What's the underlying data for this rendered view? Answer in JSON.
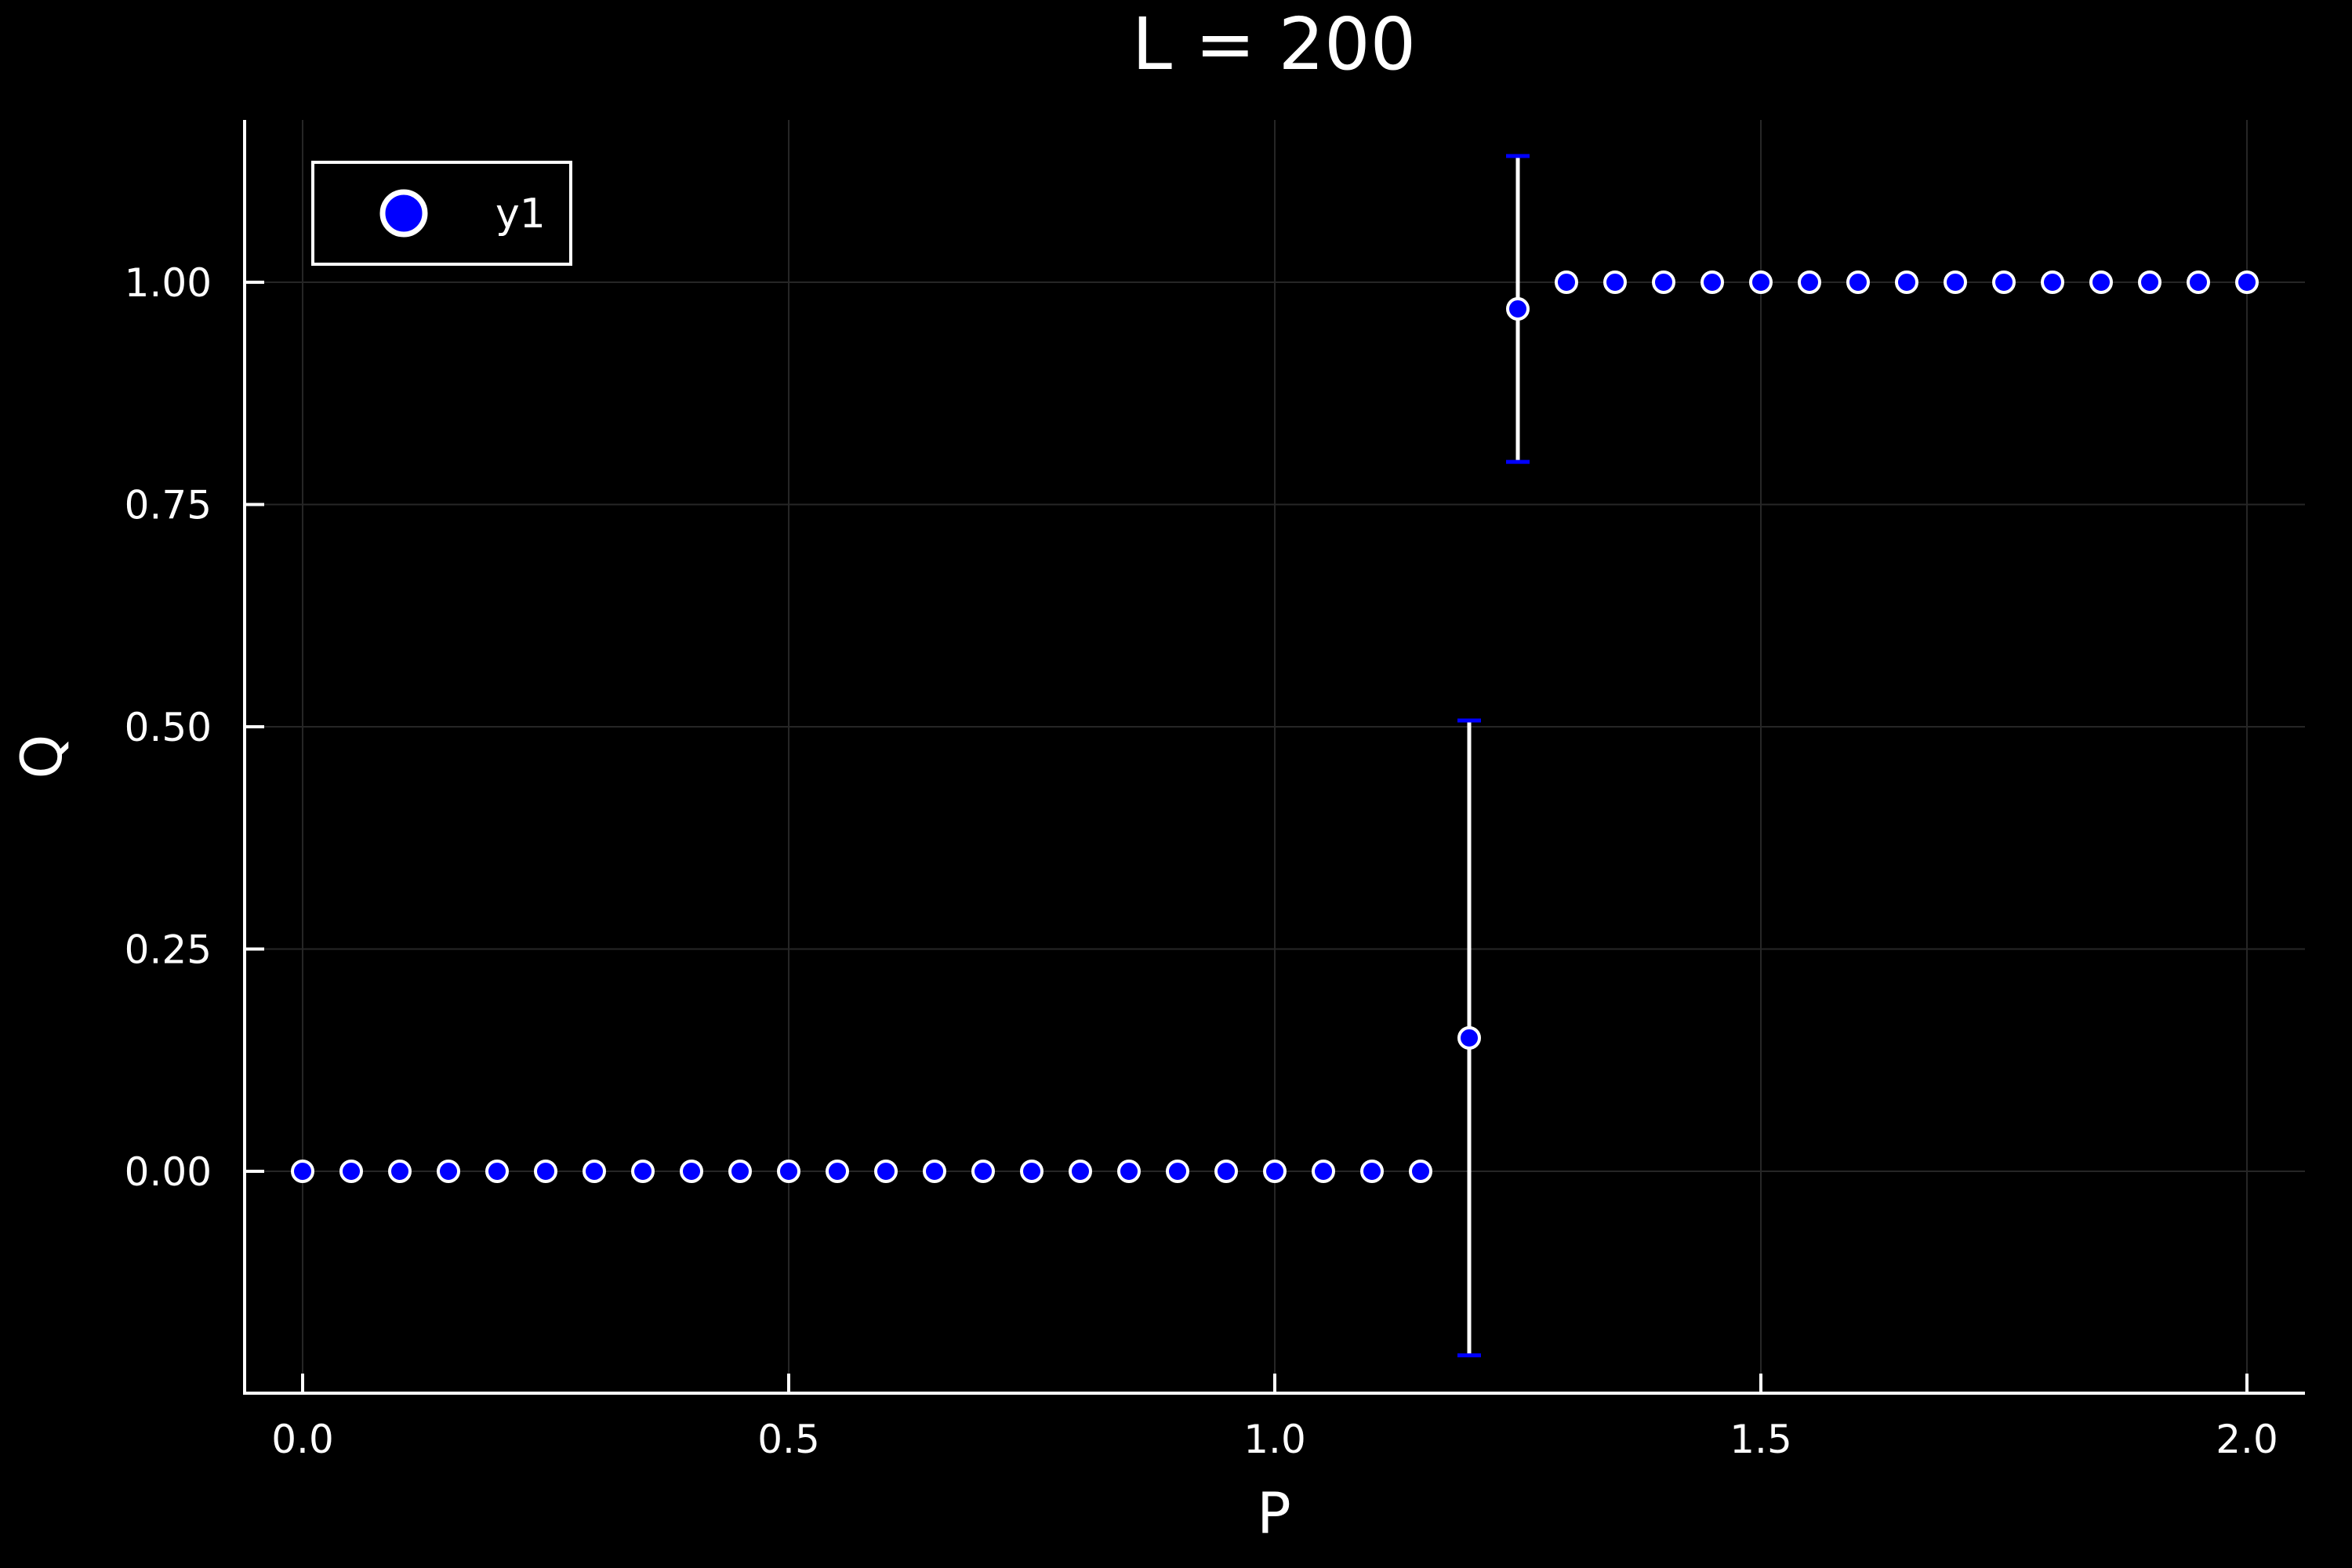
{
  "chart_data": {
    "type": "scatter",
    "title": "L = 200",
    "xlabel": "P",
    "ylabel": "Q",
    "xlim": [
      -0.06,
      2.06
    ],
    "ylim": [
      -0.25,
      1.18
    ],
    "xticks": [
      0.0,
      0.5,
      1.0,
      1.5,
      2.0
    ],
    "xtick_labels": [
      "0.0",
      "0.5",
      "1.0",
      "1.5",
      "2.0"
    ],
    "yticks": [
      0.0,
      0.25,
      0.5,
      0.75,
      1.0
    ],
    "ytick_labels": [
      "0.00",
      "0.25",
      "0.50",
      "0.75",
      "1.00"
    ],
    "grid": true,
    "legend": {
      "position": "top-left",
      "entries": [
        "y1"
      ]
    },
    "series": [
      {
        "name": "y1",
        "color": "#0000ff",
        "edge_color": "#ffffff",
        "x": [
          0,
          0.05,
          0.1,
          0.15,
          0.2,
          0.25,
          0.3,
          0.35,
          0.4,
          0.45,
          0.5,
          0.55,
          0.6,
          0.65,
          0.7,
          0.75,
          0.8,
          0.85,
          0.9,
          0.95,
          1.0,
          1.05,
          1.1,
          1.15,
          1.2,
          1.25,
          1.3,
          1.35,
          1.4,
          1.45,
          1.5,
          1.55,
          1.6,
          1.65,
          1.7,
          1.75,
          1.8,
          1.85,
          1.9,
          1.95,
          2.0
        ],
        "y": [
          0,
          0,
          0,
          0,
          0,
          0,
          0,
          0,
          0,
          0,
          0,
          0,
          0,
          0,
          0,
          0,
          0,
          0,
          0,
          0,
          0,
          0,
          0,
          0,
          0.15,
          0.97,
          1,
          1,
          1,
          1,
          1,
          1,
          1,
          1,
          1,
          1,
          1,
          1,
          1,
          1,
          1
        ],
        "yerr": [
          0,
          0,
          0,
          0,
          0,
          0,
          0,
          0,
          0,
          0,
          0,
          0,
          0,
          0,
          0,
          0,
          0,
          0,
          0,
          0,
          0,
          0,
          0,
          0,
          0.357,
          0.172,
          0,
          0,
          0,
          0,
          0,
          0,
          0,
          0,
          0,
          0,
          0,
          0,
          0,
          0,
          0
        ]
      }
    ]
  }
}
